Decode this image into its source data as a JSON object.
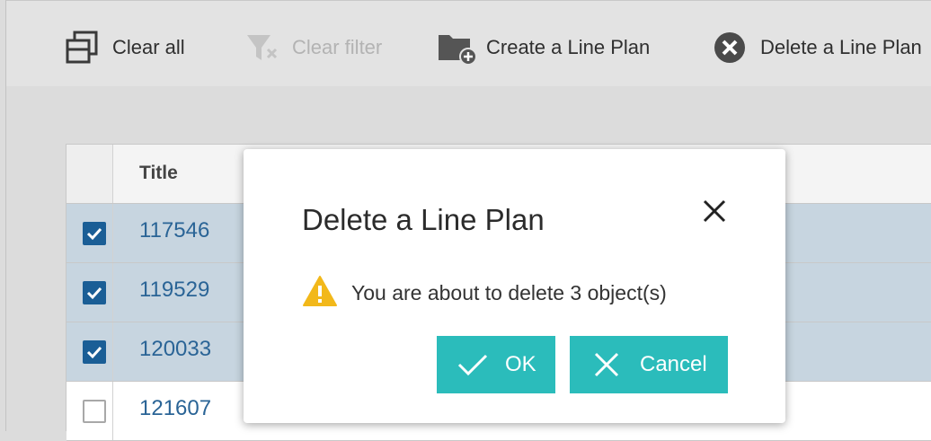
{
  "toolbar": {
    "clear_all": "Clear all",
    "clear_filter": "Clear filter",
    "create_line_plan": "Create a Line Plan",
    "delete_line_plan": "Delete a Line Plan"
  },
  "grid": {
    "header_title": "Title",
    "rows": [
      {
        "title": "117546",
        "checked": true
      },
      {
        "title": "119529",
        "checked": true
      },
      {
        "title": "120033",
        "checked": true
      },
      {
        "title": "121607",
        "checked": false
      }
    ]
  },
  "dialog": {
    "title": "Delete a Line Plan",
    "message": "You are about to delete 3 object(s)",
    "ok_label": "OK",
    "cancel_label": "Cancel"
  },
  "colors": {
    "accent": "#2bbcbb",
    "checkbox": "#1a5e96",
    "link": "#2a6496",
    "warning": "#f2b81a"
  },
  "icons": [
    "clear-all-icon",
    "filter-clear-icon",
    "folder-add-icon",
    "circle-x-icon",
    "close-icon",
    "warning-icon",
    "check-icon",
    "x-icon"
  ]
}
